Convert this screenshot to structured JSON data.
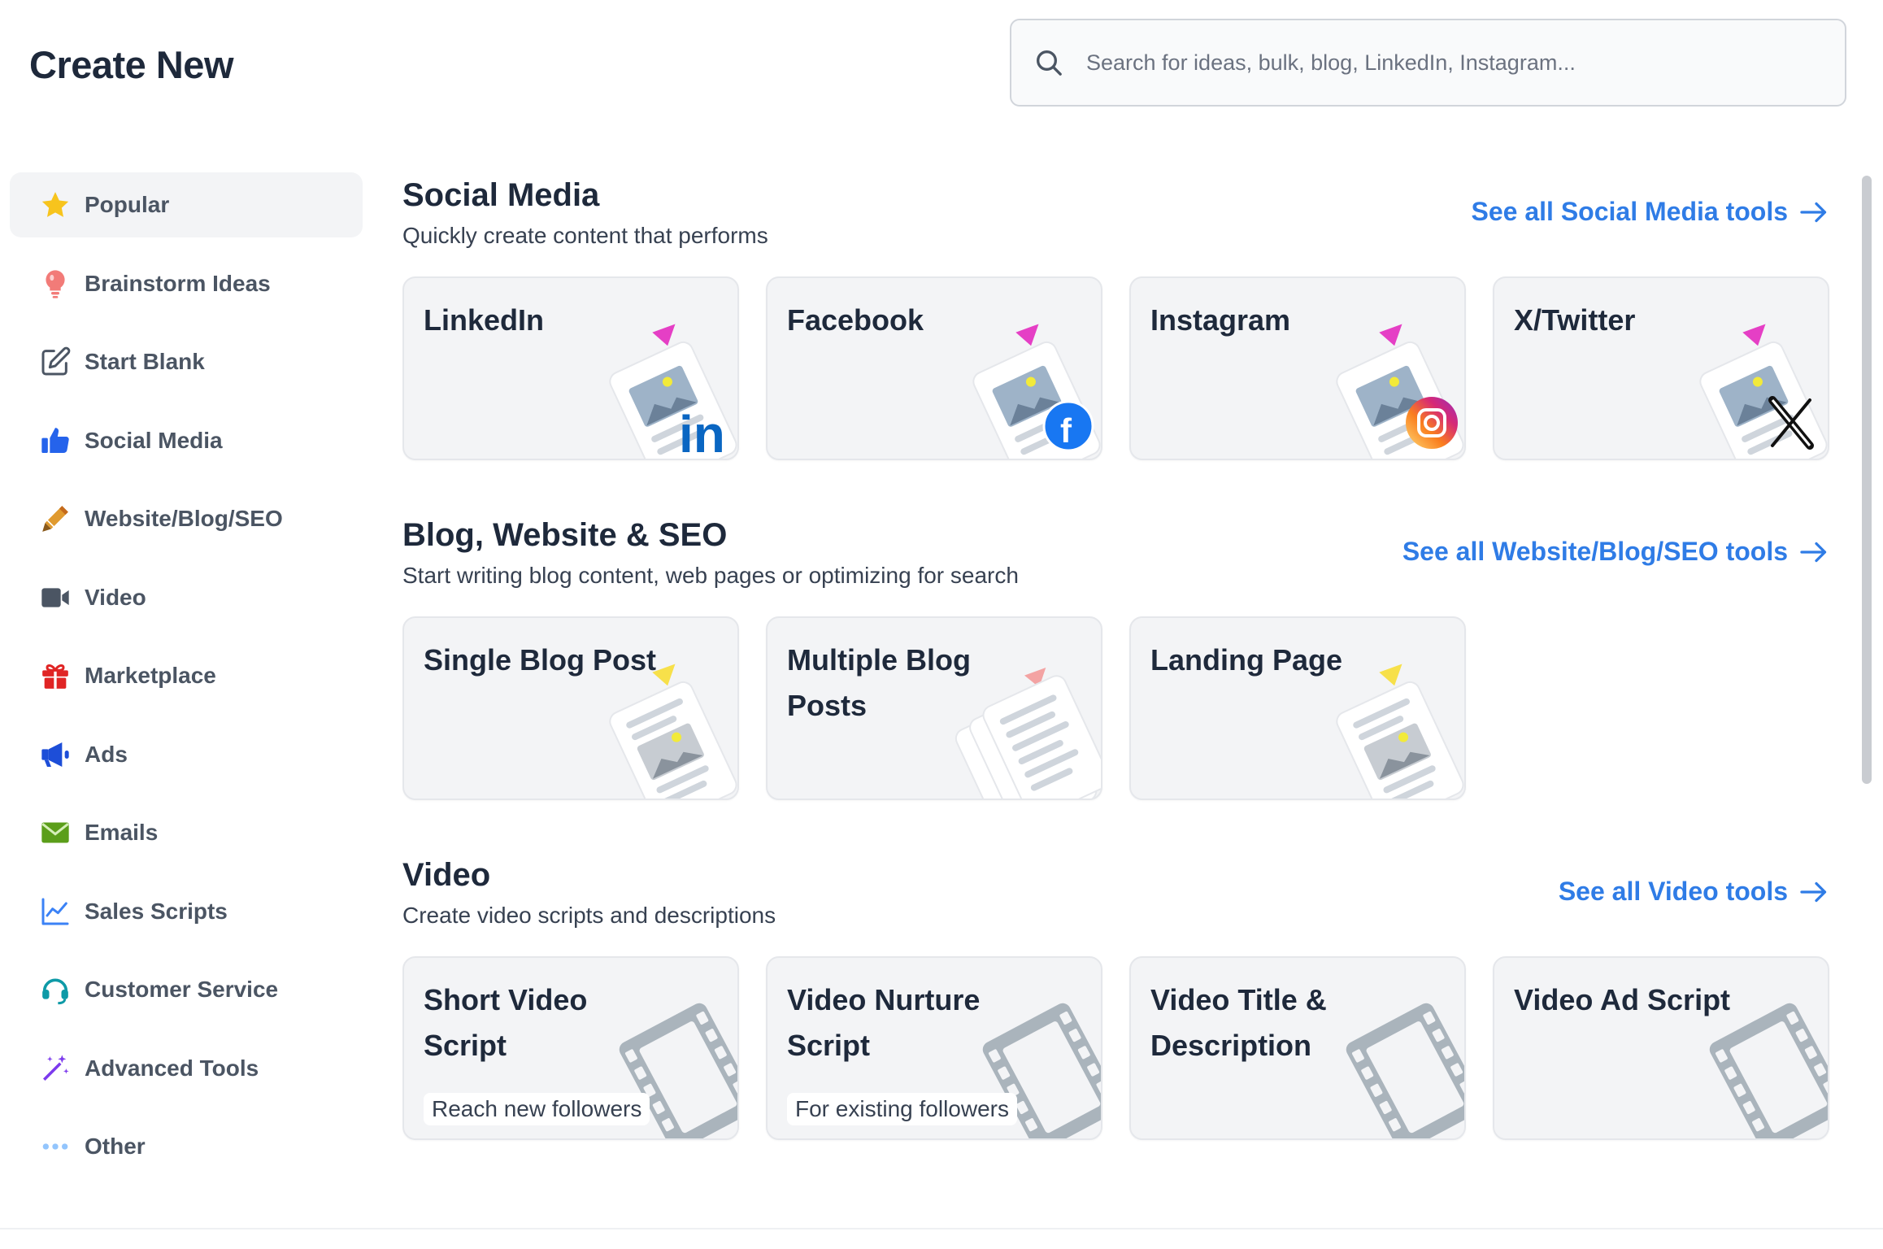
{
  "header": {
    "title": "Create New",
    "search_placeholder": "Search for ideas, bulk, blog, LinkedIn, Instagram..."
  },
  "sidebar": {
    "items": [
      {
        "label": "Popular",
        "icon": "star-icon",
        "active": true
      },
      {
        "label": "Brainstorm Ideas",
        "icon": "lightbulb-icon"
      },
      {
        "label": "Start Blank",
        "icon": "edit-icon"
      },
      {
        "label": "Social Media",
        "icon": "thumbs-up-icon"
      },
      {
        "label": "Website/Blog/SEO",
        "icon": "pencil-icon"
      },
      {
        "label": "Video",
        "icon": "video-camera-icon"
      },
      {
        "label": "Marketplace",
        "icon": "gift-icon"
      },
      {
        "label": "Ads",
        "icon": "megaphone-icon"
      },
      {
        "label": "Emails",
        "icon": "envelope-icon"
      },
      {
        "label": "Sales Scripts",
        "icon": "chart-line-icon"
      },
      {
        "label": "Customer Service",
        "icon": "headset-icon"
      },
      {
        "label": "Advanced Tools",
        "icon": "magic-wand-icon"
      },
      {
        "label": "Other",
        "icon": "more-dots-icon"
      }
    ]
  },
  "sections": [
    {
      "title": "Social Media",
      "subtitle": "Quickly create content that performs",
      "see_all": "See all Social Media tools",
      "cards": [
        {
          "title": "LinkedIn",
          "art": "linkedin"
        },
        {
          "title": "Facebook",
          "art": "facebook"
        },
        {
          "title": "Instagram",
          "art": "instagram"
        },
        {
          "title": "X/Twitter",
          "art": "x"
        }
      ]
    },
    {
      "title": "Blog, Website & SEO",
      "subtitle": "Start writing blog content, web pages or optimizing for search",
      "see_all": "See all Website/Blog/SEO tools",
      "cards": [
        {
          "title": "Single Blog Post",
          "art": "blog"
        },
        {
          "title": "Multiple Blog Posts",
          "art": "multi-blog"
        },
        {
          "title": "Landing Page",
          "art": "blog"
        }
      ]
    },
    {
      "title": "Video",
      "subtitle": "Create video scripts and descriptions",
      "see_all": "See all Video tools",
      "cards": [
        {
          "title": "Short Video Script",
          "subtitle": "Reach new followers",
          "art": "film"
        },
        {
          "title": "Video Nurture Script",
          "subtitle": "For existing followers",
          "art": "film"
        },
        {
          "title": "Video Title & Description",
          "art": "film"
        },
        {
          "title": "Video Ad Script",
          "art": "film"
        }
      ]
    }
  ],
  "colors": {
    "link": "#2f7ce6",
    "linkedin": "#0a66c2",
    "facebook": "#1877f2",
    "triangle_social": "#e53fc5",
    "triangle_blog": "#f7e04a"
  }
}
